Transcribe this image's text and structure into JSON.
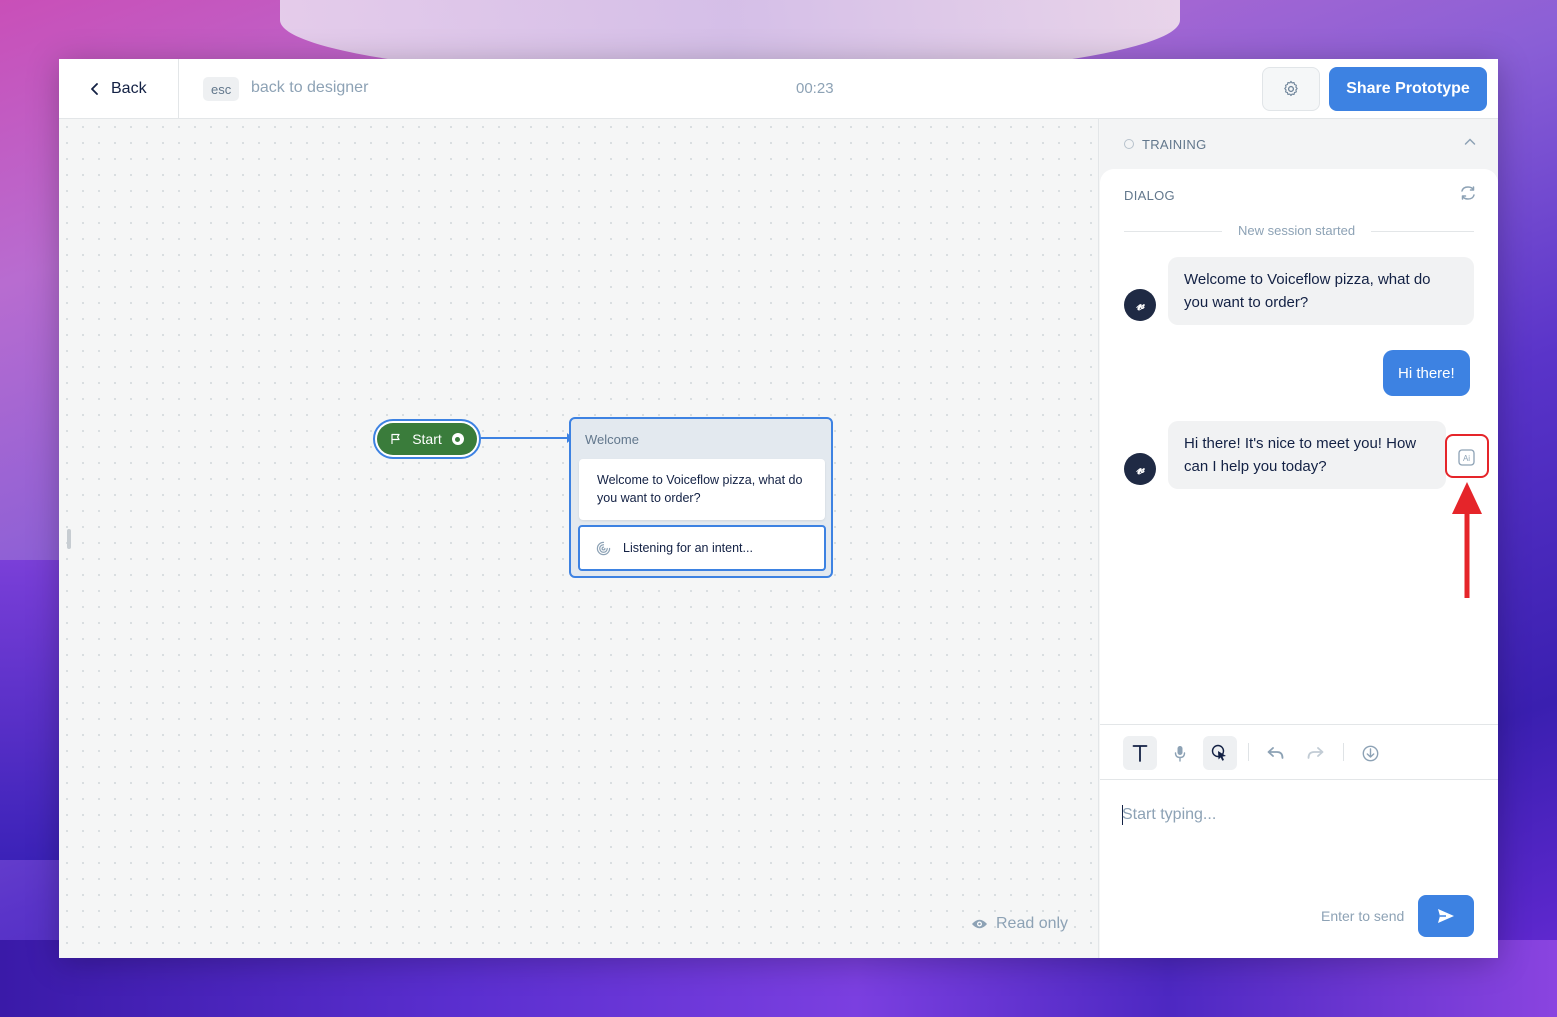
{
  "header": {
    "back_label": "Back",
    "esc_label": "esc",
    "back_to_designer": "back to designer",
    "timer": "00:23",
    "share_label": "Share Prototype"
  },
  "canvas": {
    "start_label": "Start",
    "block_title": "Welcome",
    "block_speak_text": "Welcome to Voiceflow pizza, what do you want to order?",
    "block_listen_text": "Listening for an intent...",
    "read_only": "Read only"
  },
  "panel": {
    "training_label": "TRAINING",
    "dialog_title": "DIALOG",
    "session_text": "New session started",
    "messages": [
      {
        "role": "bot",
        "text": "Welcome to Voiceflow pizza, what do you want to order?"
      },
      {
        "role": "user",
        "text": "Hi there!"
      },
      {
        "role": "bot",
        "text": "Hi there! It's nice to meet you! How can I help you today?"
      }
    ],
    "bot_avatar": "𝓋",
    "input_placeholder": "Start typing...",
    "enter_hint": "Enter to send"
  },
  "colors": {
    "accent": "#3d82e2",
    "start_green": "#3a7c3b",
    "highlight_red": "#e5252a"
  },
  "icons": [
    "chevron-left-icon",
    "gear-icon",
    "flag-icon",
    "listen-icon",
    "eye-icon",
    "chevron-up-icon",
    "refresh-icon",
    "ai-icon",
    "text-icon",
    "microphone-icon",
    "touch-icon",
    "undo-icon",
    "redo-icon",
    "download-icon",
    "send-icon",
    "arrow-up-icon"
  ]
}
